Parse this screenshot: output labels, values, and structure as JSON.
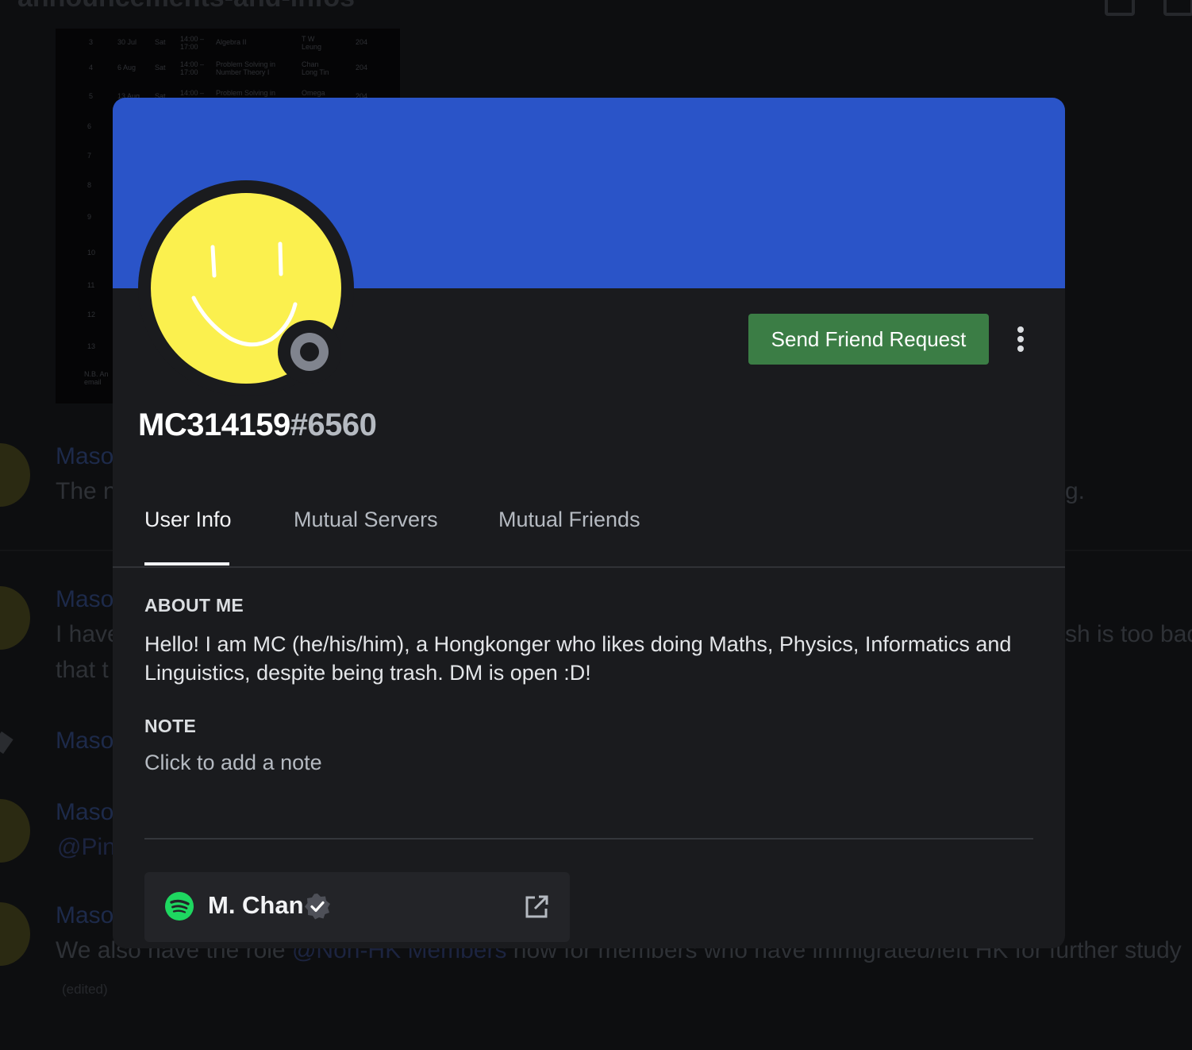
{
  "background": {
    "channel_title": "announcements-and-infos",
    "schedule_rows": [
      {
        "num": "3",
        "date": "30 Jul",
        "day": "Sat",
        "time": "14:00 –\n17:00",
        "course": "Algebra II",
        "tutor": "T W\nLeung",
        "room": "204"
      },
      {
        "num": "4",
        "date": "6 Aug",
        "day": "Sat",
        "time": "14:00 –\n17:00",
        "course": "Problem Solving in\nNumber Theory I",
        "tutor": "Chan\nLong Tin",
        "room": "204"
      },
      {
        "num": "5",
        "date": "13 Aug",
        "day": "Sat",
        "time": "14:00 –",
        "course": "Problem Solving in",
        "tutor": "Omega",
        "room": "204"
      }
    ],
    "row_numbers": [
      "6",
      "7",
      "8",
      "9",
      "10",
      "11",
      "12",
      "13"
    ],
    "schedule_note": "N.B. An\nemail",
    "messages": [
      {
        "author": "Maso",
        "text": "The n",
        "tail": "g."
      },
      {
        "author": "Maso",
        "text": "I have",
        "text2": "that t",
        "tail": "sh is too bad"
      },
      {
        "author": "Maso"
      },
      {
        "author": "Maso",
        "text": "@Pin"
      },
      {
        "author": "Maso",
        "text_pre": "We also have the role ",
        "mention": "@Non-HK Members",
        "text_post": " now for members who have immigrated/left HK for further study"
      }
    ],
    "edited": "(edited)"
  },
  "profile": {
    "banner_color": "#2a54c8",
    "avatar": "yellow-smiley-avatar",
    "status": "offline",
    "send_friend_request_label": "Send Friend Request",
    "more_icon": "more-vertical-icon",
    "username": "MC314159",
    "discriminator": "#6560",
    "tabs": [
      {
        "label": "User Info",
        "active": true
      },
      {
        "label": "Mutual Servers",
        "active": false
      },
      {
        "label": "Mutual Friends",
        "active": false
      }
    ],
    "about_title": "ABOUT ME",
    "about_text": "Hello! I am MC (he/his/him), a Hongkonger who likes doing Maths, Physics, Informatics and Linguistics, despite being trash. DM is open :D!",
    "note_title": "NOTE",
    "note_placeholder": "Click to add a note",
    "connection": {
      "service_icon": "spotify-icon",
      "name": "M. Chan",
      "verified_icon": "verified-icon",
      "open_icon": "external-link-icon"
    }
  },
  "colors": {
    "button_green": "#3b7d45",
    "modal_bg": "#1a1b1e",
    "accent_blue": "#2a54c8"
  }
}
